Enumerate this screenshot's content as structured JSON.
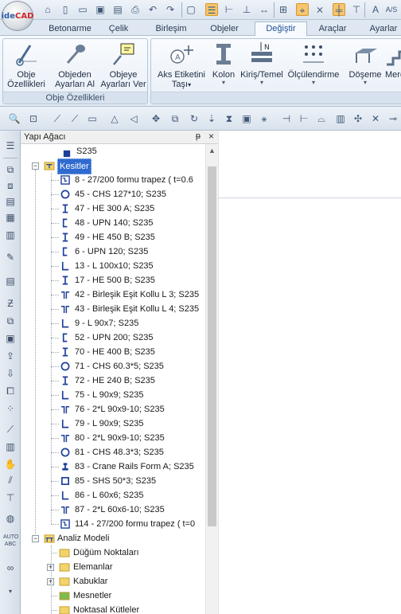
{
  "app": {
    "logo_text_a": "ide",
    "logo_text_b": "CAD"
  },
  "quick_access": {
    "icons": [
      "home-icon",
      "new-file-icon",
      "open-folder-icon",
      "save-icon",
      "save-as-icon",
      "print-icon",
      "undo-icon",
      "redo-icon",
      "window-icon",
      "layer-icon",
      "align-icon",
      "snap-icon",
      "dimension-icon",
      "grid-icon",
      "node-icon",
      "beam-icon",
      "axis-icon",
      "measure-icon",
      "text-icon"
    ],
    "last_label": "A/S"
  },
  "ribbon": {
    "tabs": [
      "Betonarme",
      "Çelik",
      "Birleşim",
      "Objeler",
      "Değiştir",
      "Araçlar",
      "Ayarlar"
    ],
    "active_tab": "Değiştir",
    "groups": [
      {
        "title": "Obje Özellikleri",
        "buttons": [
          {
            "line1": "Obje",
            "line2": "Özellikleri",
            "icon": "properties-icon"
          },
          {
            "line1": "Objeden",
            "line2": "Ayarları Al",
            "icon": "eyedropper-icon"
          },
          {
            "line1": "Objeye",
            "line2": "Ayarları Ver",
            "icon": "apply-settings-icon"
          }
        ]
      },
      {
        "title": "",
        "buttons": [
          {
            "line1": "Aks Etiketini",
            "line2": "Taşı",
            "icon": "axis-label-move-icon"
          },
          {
            "line1": "Kolon",
            "line2": "",
            "icon": "column-icon"
          },
          {
            "line1": "Kiriş/Temel",
            "line2": "",
            "icon": "beam-foundation-icon"
          },
          {
            "line1": "Ölçülendirme",
            "line2": "",
            "icon": "dimensioning-icon"
          },
          {
            "line1": "Döşeme",
            "line2": "",
            "icon": "slab-icon"
          },
          {
            "line1": "Merd",
            "line2": "",
            "icon": "stair-icon"
          }
        ]
      }
    ]
  },
  "panel": {
    "title": "Yapı Ağacı",
    "pin": "ᵽ",
    "close": "×"
  },
  "tree": {
    "top_item": {
      "label": "S235",
      "icon": "square-filled-icon"
    },
    "sections_node": {
      "label": "Kesitler",
      "icon": "section-folder-icon"
    },
    "sections": [
      {
        "label": "8 - 27/200 formu trapez ( t=0.6",
        "icon": "trapez-icon"
      },
      {
        "label": "45 - CHS 127*10; S235",
        "icon": "circle-icon"
      },
      {
        "label": "47 - HE 300 A; S235",
        "icon": "i-beam-icon"
      },
      {
        "label": "48 - UPN 140; S235",
        "icon": "channel-icon"
      },
      {
        "label": "49 - HE 450 B; S235",
        "icon": "i-beam-icon"
      },
      {
        "label": "6 - UPN 120; S235",
        "icon": "channel-icon"
      },
      {
        "label": "13 - L 100x10; S235",
        "icon": "angle-icon"
      },
      {
        "label": "17 - HE 500 B; S235",
        "icon": "i-beam-icon"
      },
      {
        "label": "42 - Birleşik Eşit Kollu L 3; S235",
        "icon": "double-angle-icon"
      },
      {
        "label": "43 - Birleşik Eşit Kollu L 4; S235",
        "icon": "double-angle-icon"
      },
      {
        "label": "9 - L 90x7; S235",
        "icon": "angle-icon"
      },
      {
        "label": "52 - UPN 200; S235",
        "icon": "channel-icon"
      },
      {
        "label": "70 - HE 400 B; S235",
        "icon": "i-beam-icon"
      },
      {
        "label": "71 - CHS 60.3*5; S235",
        "icon": "circle-icon"
      },
      {
        "label": "72 - HE 240 B; S235",
        "icon": "i-beam-icon"
      },
      {
        "label": "75 - L 90x9; S235",
        "icon": "angle-icon"
      },
      {
        "label": "76 - 2*L 90x9-10; S235",
        "icon": "double-angle-icon"
      },
      {
        "label": "79 - L 90x9; S235",
        "icon": "angle-icon"
      },
      {
        "label": "80 - 2*L 90x9-10; S235",
        "icon": "double-angle-icon"
      },
      {
        "label": "81 - CHS 48.3*3; S235",
        "icon": "circle-icon"
      },
      {
        "label": "83 - Crane Rails Form A; S235",
        "icon": "rail-icon"
      },
      {
        "label": "85 - SHS 50*3; S235",
        "icon": "square-icon"
      },
      {
        "label": "86 - L 60x6; S235",
        "icon": "angle-icon"
      },
      {
        "label": "87 - 2*L 60x6-10; S235",
        "icon": "double-angle-icon"
      },
      {
        "label": "114 - 27/200 formu trapez ( t=0",
        "icon": "trapez-icon"
      }
    ],
    "analysis_node": {
      "label": "Analiz Modeli",
      "icon": "analysis-model-icon"
    },
    "analysis_children": [
      {
        "label": "Düğüm Noktaları",
        "expandable": false,
        "icon": "folder-icon"
      },
      {
        "label": "Elemanlar",
        "expandable": true,
        "icon": "folder-icon"
      },
      {
        "label": "Kabuklar",
        "expandable": true,
        "icon": "folder-icon"
      },
      {
        "label": "Mesnetler",
        "expandable": false,
        "icon": "support-folder-icon"
      },
      {
        "label": "Noktasal Kütleler",
        "expandable": false,
        "icon": "folder-icon"
      }
    ]
  },
  "colors": {
    "selection": "#2f6ad0",
    "section_icon": "#1d3f9a",
    "folder": "#f2d36b"
  }
}
